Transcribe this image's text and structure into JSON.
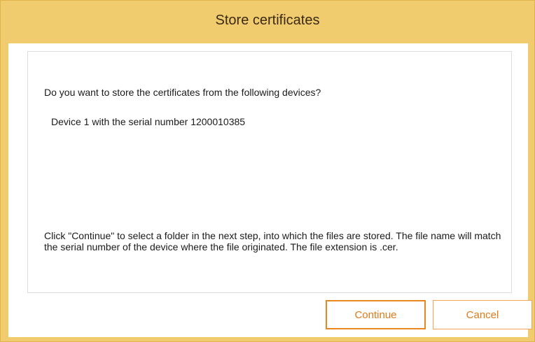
{
  "window": {
    "title": "Store certificates"
  },
  "content": {
    "question": "Do you want to store the certificates from the following devices?",
    "devices": [
      "Device 1 with the serial number 1200010385"
    ],
    "info": "Click \"Continue\" to select a folder in the next step, into which the files are stored. The file name will match the serial number of the device where the file originated. The file extension is .cer."
  },
  "buttons": {
    "continue_label": "Continue",
    "cancel_label": "Cancel"
  },
  "colors": {
    "titlebar": "#f1cc6e",
    "button_text": "#e07b1a",
    "button_border": "#e8861f"
  }
}
